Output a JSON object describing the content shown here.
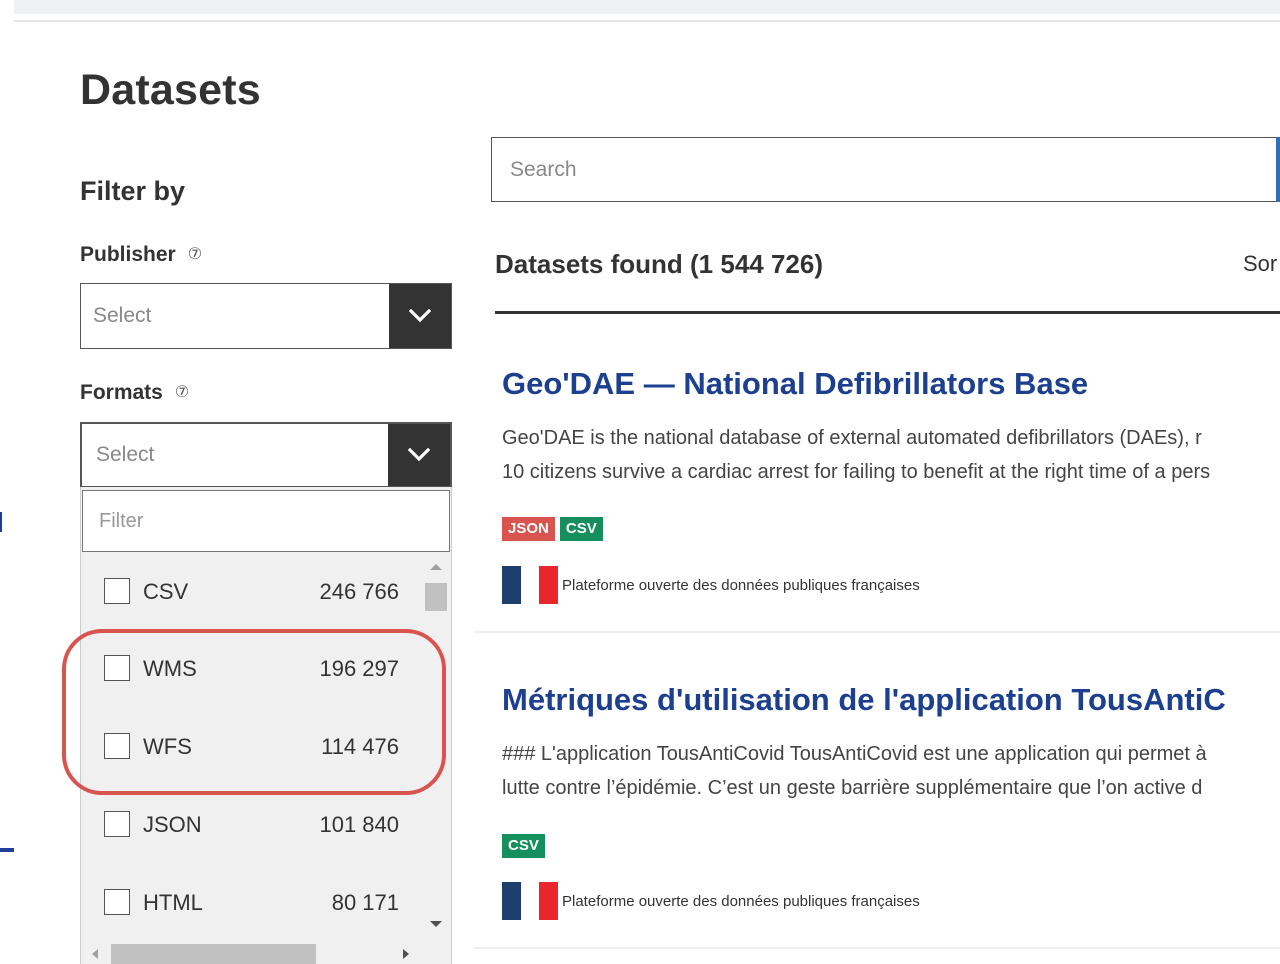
{
  "page": {
    "title": "Datasets",
    "accent_color": "#1d3f8f",
    "highlight_color": "#d9534f"
  },
  "filters": {
    "heading": "Filter by",
    "help_icon": "help-circle-icon",
    "publisher": {
      "label": "Publisher",
      "help_glyph": "⑦",
      "placeholder": "Select"
    },
    "formats": {
      "label": "Formats",
      "help_glyph": "⑦",
      "placeholder": "Select",
      "filter_placeholder": "Filter",
      "options": [
        {
          "name": "CSV",
          "count": "246 766"
        },
        {
          "name": "WMS",
          "count": "196 297"
        },
        {
          "name": "WFS",
          "count": "114 476"
        },
        {
          "name": "JSON",
          "count": "101 840"
        },
        {
          "name": "HTML",
          "count": "80 171"
        }
      ]
    }
  },
  "search": {
    "placeholder": "Search"
  },
  "results": {
    "count_label": "Datasets found (1 544 726)",
    "sort_label": "Sor",
    "items": [
      {
        "title": "Geo'DAE — National Defibrillators Base",
        "description_lines": [
          "Geo'DAE is the national database of external automated defibrillators (DAEs), r",
          "10 citizens survive a cardiac arrest for failing to benefit at the right time of a pers"
        ],
        "formats": [
          "JSON",
          "CSV"
        ],
        "publisher": "Plateforme ouverte des données publiques françaises"
      },
      {
        "title": "Métriques d'utilisation de l'application TousAntiC",
        "description_lines": [
          "### L'application TousAntiCovid TousAntiCovid est une application qui permet à",
          "lutte contre l’épidémie. C’est un geste barrière supplémentaire que l’on active d"
        ],
        "formats": [
          "CSV"
        ],
        "publisher": "Plateforme ouverte des données publiques françaises"
      }
    ]
  },
  "badge_colors": {
    "JSON": "#d9534f",
    "CSV": "#168f5e"
  },
  "flag_colors": {
    "blue": "#1d3f6e",
    "red": "#e8262b"
  }
}
